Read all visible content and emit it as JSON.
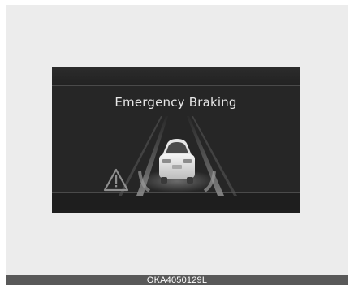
{
  "display": {
    "title": "Emergency Braking",
    "warning_icon": "warning-triangle-icon",
    "vehicle_icon": "car-rear-view-icon"
  },
  "caption": {
    "code": "OKA4050129L"
  },
  "colors": {
    "screen_background": "#262626",
    "text": "#e8e8e8",
    "caption_bar": "#595959",
    "page_background": "#ececec"
  }
}
